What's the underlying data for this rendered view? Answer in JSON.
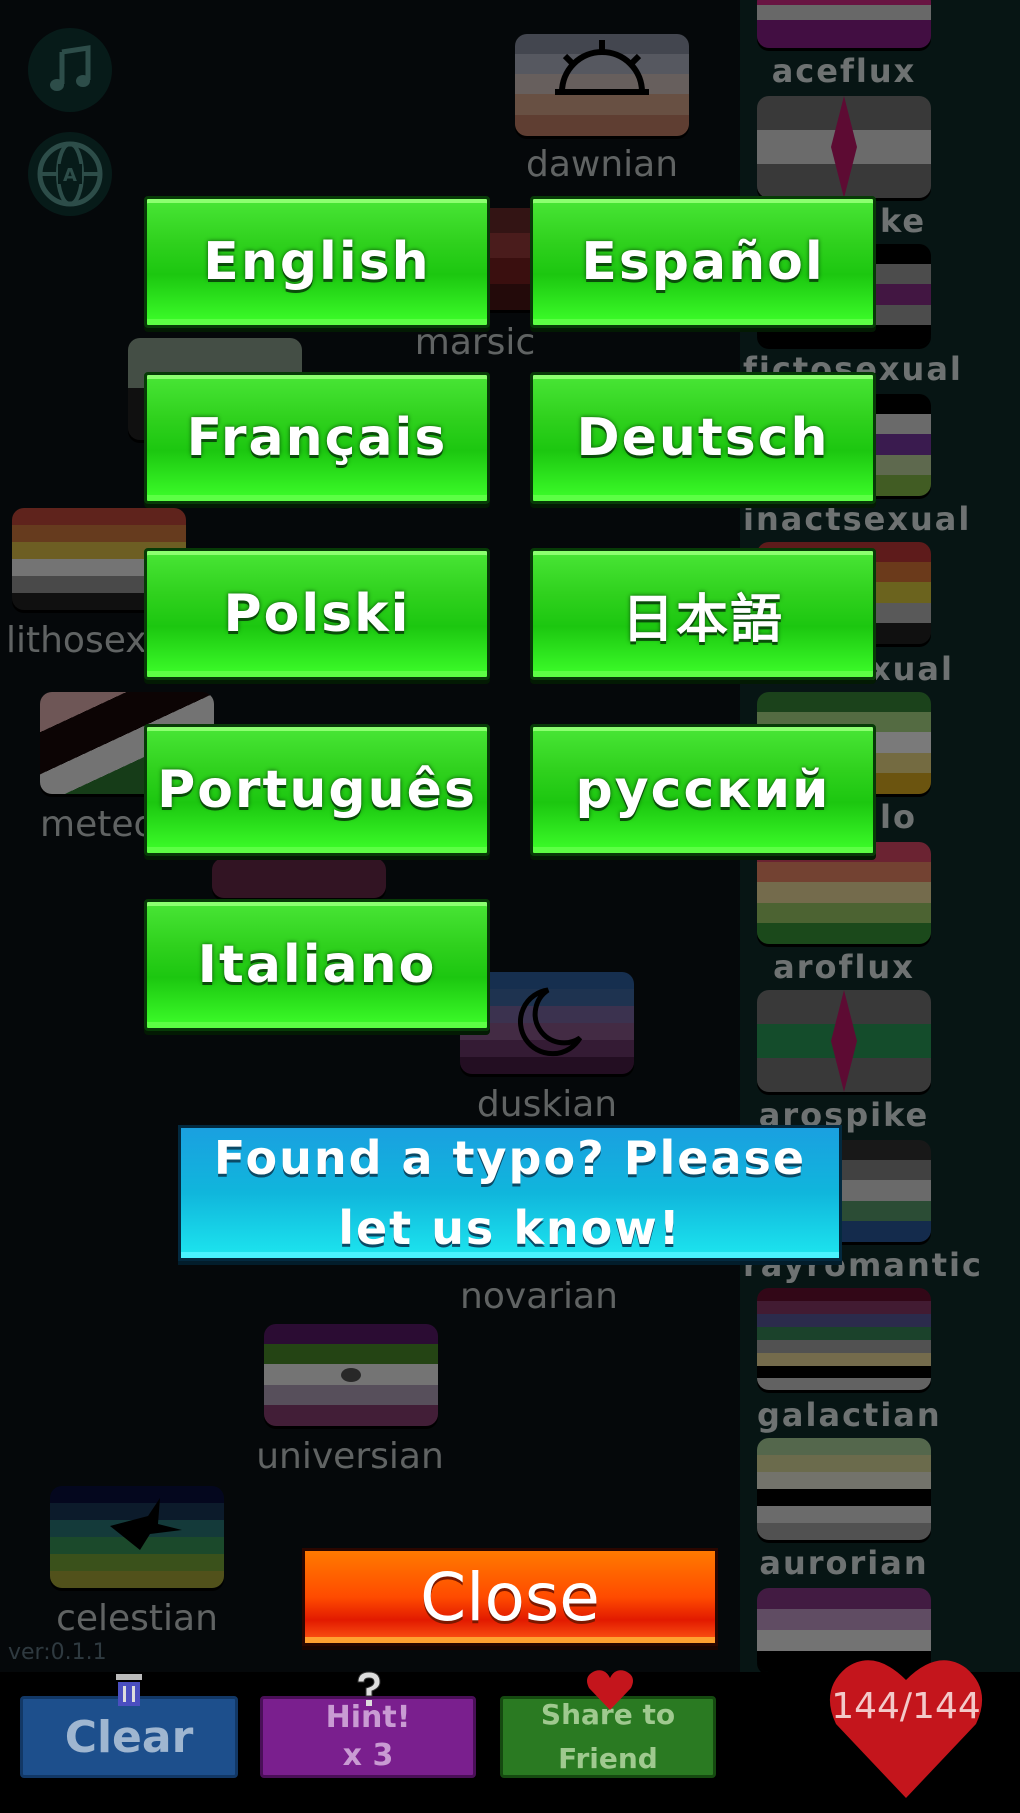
{
  "language_buttons": [
    {
      "label": "English"
    },
    {
      "label": "Español"
    },
    {
      "label": "Français"
    },
    {
      "label": "Deutsch"
    },
    {
      "label": "Polski"
    },
    {
      "label": "日本語"
    },
    {
      "label": "Português"
    },
    {
      "label": "русский"
    },
    {
      "label": "Italiano"
    }
  ],
  "typo_button": {
    "line1": "Found a typo? Please",
    "line2": "let us know!"
  },
  "close_button": {
    "label": "Close"
  },
  "board_labels": {
    "dawnian": "dawnian",
    "marsic": "marsic",
    "lithosex": "lithosex",
    "meteo": "meteo",
    "duskian": "duskian",
    "novarian": "novarian",
    "universian": "universian",
    "celestian": "celestian"
  },
  "sidebar_labels": {
    "aceflux": "aceflux",
    "acespike_partial": "ke",
    "fictosexual": "fictosexual",
    "inactsexual": "inactsexual",
    "xual_partial": "xual",
    "lo_partial": "lo",
    "aroflux": "aroflux",
    "arospike": "arospike",
    "grayromantic": "rayromantic",
    "galactian": "galactian",
    "aurorian": "aurorian"
  },
  "version": "ver:0.1.1",
  "bottom_bar": {
    "clear_label": "Clear",
    "hint_label_line1": "Hint!",
    "hint_label_line2": "x 3",
    "share_label_line1": "Share to",
    "share_label_line2": "Friend",
    "progress": "144/144"
  },
  "colors": {
    "green_button": "#2fd11d",
    "typo_button": "#10b6dc",
    "close_button": "#ff4b00",
    "clear_button": "#1d5fa8",
    "hint_button": "#8a1fa0",
    "share_button": "#2c7f24",
    "heart": "#c4151c"
  },
  "icons": [
    "music-note-icon",
    "globe-language-icon",
    "trash-icon",
    "question-mark-icon",
    "heart-icon"
  ]
}
